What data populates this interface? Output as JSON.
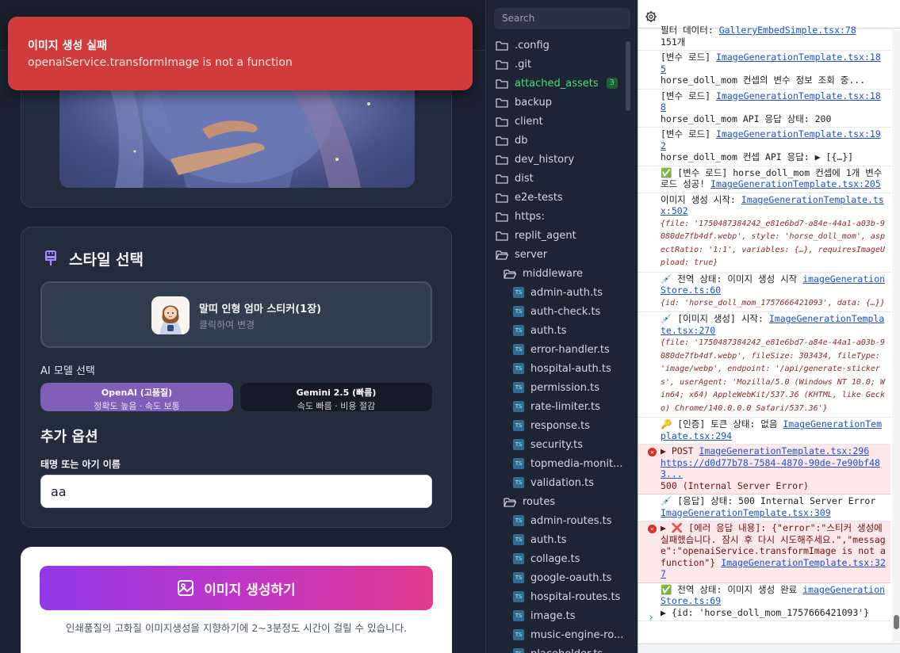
{
  "toast": {
    "title": "이미지 생성 실패",
    "message": "openaiService.transformImage is not a function"
  },
  "style_section": {
    "title": "스타일 선택",
    "concept_title": "말띠 인형 엄마 스티커(1장)",
    "concept_hint": "클릭하여 변경",
    "ai_model_label": "AI 모델 선택",
    "models": [
      {
        "name": "OpenAI (고품질)",
        "desc": "정확도 높음 · 속도 보통"
      },
      {
        "name": "Gemini 2.5 (빠름)",
        "desc": "속도 빠름 · 비용 절감"
      }
    ],
    "options_title": "추가 옵션",
    "name_label": "태명 또는 아기 이름",
    "name_value": "aa"
  },
  "generate": {
    "button_label": "이미지 생성하기",
    "note": "인쇄품질의 고화질 이미지생성을 지향하기에 2~3분정도 시간이 걸릴 수 있습니다."
  },
  "file_tree": {
    "search_placeholder": "Search",
    "items": [
      {
        "name": ".config",
        "type": "folder"
      },
      {
        "name": ".git",
        "type": "folder"
      },
      {
        "name": "attached_assets",
        "type": "folder",
        "badge": "3"
      },
      {
        "name": "backup",
        "type": "folder"
      },
      {
        "name": "client",
        "type": "folder"
      },
      {
        "name": "db",
        "type": "folder"
      },
      {
        "name": "dev_history",
        "type": "folder"
      },
      {
        "name": "dist",
        "type": "folder"
      },
      {
        "name": "e2e-tests",
        "type": "folder"
      },
      {
        "name": "https:",
        "type": "folder"
      },
      {
        "name": "replit_agent",
        "type": "folder"
      },
      {
        "name": "server",
        "type": "folder-open"
      },
      {
        "name": "middleware",
        "type": "folder-open"
      },
      {
        "name": "admin-auth.ts",
        "type": "ts"
      },
      {
        "name": "auth-check.ts",
        "type": "ts"
      },
      {
        "name": "auth.ts",
        "type": "ts"
      },
      {
        "name": "error-handler.ts",
        "type": "ts"
      },
      {
        "name": "hospital-auth.ts",
        "type": "ts"
      },
      {
        "name": "permission.ts",
        "type": "ts"
      },
      {
        "name": "rate-limiter.ts",
        "type": "ts"
      },
      {
        "name": "response.ts",
        "type": "ts"
      },
      {
        "name": "security.ts",
        "type": "ts"
      },
      {
        "name": "topmedia-monit...",
        "type": "ts"
      },
      {
        "name": "validation.ts",
        "type": "ts"
      },
      {
        "name": "routes",
        "type": "folder-open"
      },
      {
        "name": "admin-routes.ts",
        "type": "ts"
      },
      {
        "name": "auth.ts",
        "type": "ts"
      },
      {
        "name": "collage.ts",
        "type": "ts"
      },
      {
        "name": "google-oauth.ts",
        "type": "ts"
      },
      {
        "name": "hospital-routes.ts",
        "type": "ts"
      },
      {
        "name": "image.ts",
        "type": "ts"
      },
      {
        "name": "music-engine-ro...",
        "type": "ts"
      },
      {
        "name": "placeholder.ts",
        "type": "ts"
      }
    ]
  },
  "console": {
    "entries": [
      {
        "msg": "필터 데이터:",
        "src": "GalleryEmbedSimple.tsx:78",
        "extra": "151개"
      },
      {
        "msg": "[변수 로드]",
        "src": "ImageGenerationTemplate.tsx:185",
        "extra": "horse_doll_mom 컨셉의 변수 정보 조회 중..."
      },
      {
        "msg": "[변수 로드]",
        "src": "ImageGenerationTemplate.tsx:188",
        "extra": "horse_doll_mom API 응답 상태: 200"
      },
      {
        "msg": "[변수 로드]",
        "src": "ImageGenerationTemplate.tsx:192",
        "extra": "horse_doll_mom 컨셉 API 응답: ▶ [{…}]"
      },
      {
        "msg": "✅ [변수 로드] horse_doll_mom 컨셉에 1개 변수 로드 성공!",
        "src": "ImageGenerationTemplate.tsx:205",
        "extra": ""
      },
      {
        "msg": "이미지 생성 시작:",
        "src": "ImageGenerationTemplate.tsx:502",
        "extra": "{file: '1750487384242_e81e6bd7-a84e-44a1-a03b-9080de7fb4df.webp', style: 'horse_doll_mom', aspectRatio: '1:1', variables: {…}, requiresImageUpload: true}"
      },
      {
        "msg": "💉 전역 상태: 이미지 생성 시작",
        "src": "imageGenerationStore.ts:60",
        "extra": "{id: 'horse_doll_mom_1757666421093', data: {…}}"
      },
      {
        "msg": "💉 [이미지 생성] 시작:",
        "src": "ImageGenerationTemplate.tsx:270",
        "extra": "{file: '1750487384242_e81e6bd7-a84e-44a1-a03b-9080de7fb4df.webp', fileSize: 303434, fileType: 'image/webp', endpoint: '/api/generate-stickers', userAgent: 'Mozilla/5.0 (Windows NT 10.0; Win64; x64) AppleWebKit/537.36 (KHTML, like Gecko) Chrome/140.0.0.0 Safari/537.36'}"
      },
      {
        "msg": "🔑 [인증] 토큰 상태: 없음",
        "src": "ImageGenerationTemplate.tsx:294",
        "extra": ""
      },
      {
        "msg": "▶ POST",
        "src": "ImageGenerationTemplate.tsx:296",
        "url": "https://d0d77b78-7584-4870-90de-7e90bf483...",
        "extra": "500 (Internal Server Error)",
        "error": true
      },
      {
        "msg": "💉 [응답] 상태: 500 Internal Server Error",
        "src": "ImageGenerationTemplate.tsx:309",
        "extra": ""
      },
      {
        "msg": "▶ ❌ [에러 응답 내용]: {\"error\":\"스티커 생성에 실패했습니다. 잠시 후 다시 시도해주세요.\",\"message\":\"openaiService.transformImage is not a function\"}",
        "src": "ImageGenerationTemplate.tsx:327",
        "extra": "",
        "error": true
      },
      {
        "msg": "✅ 전역 상태: 이미지 생성 완료",
        "src": "imageGenerationStore.ts:69",
        "extra": "▶ {id: 'horse_doll_mom_1757666421093'}"
      }
    ]
  }
}
